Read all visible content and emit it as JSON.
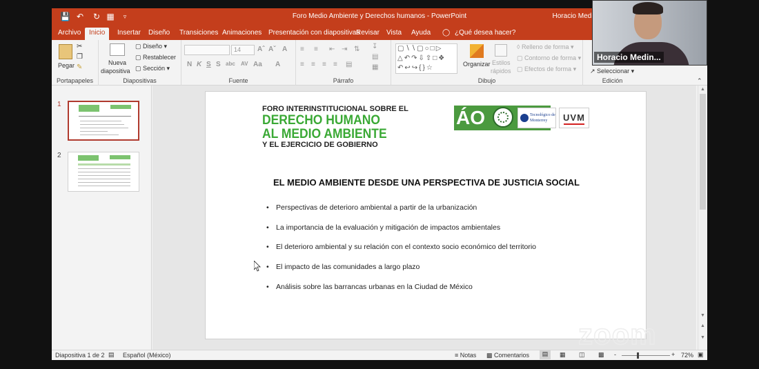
{
  "window": {
    "title": "Foro Medio Ambiente y Derechos humanos  -  PowerPoint",
    "user": "Horacio Medin"
  },
  "quick_access": {
    "icons": [
      "save-icon",
      "undo-icon",
      "redo-icon",
      "presenter-icon",
      "customize-icon"
    ]
  },
  "tabs": [
    "Archivo",
    "Inicio",
    "Insertar",
    "Diseño",
    "Transiciones",
    "Animaciones",
    "Presentación con diapositivas",
    "Revisar",
    "Vista",
    "Ayuda"
  ],
  "active_tab": "Inicio",
  "tell_me": "¿Qué desea hacer?",
  "ribbon": {
    "portapapeles": {
      "label": "Portapapeles",
      "paste": "Pegar"
    },
    "diapositivas": {
      "label": "Diapositivas",
      "nueva": "Nueva",
      "nueva2": "diapositiva",
      "diseno": "Diseño",
      "restablecer": "Restablecer",
      "seccion": "Sección"
    },
    "fuente": {
      "label": "Fuente",
      "size": "14"
    },
    "parrafo": {
      "label": "Párrafo"
    },
    "dibujo": {
      "label": "Dibujo",
      "organizar": "Organizar",
      "estilos1": "Estilos",
      "estilos2": "rápidos",
      "relleno": "Relleno de forma",
      "contorno": "Contorno de forma",
      "efectos": "Efectos de forma"
    },
    "edicion": {
      "label": "Edición",
      "seleccionar": "Seleccionar"
    }
  },
  "thumbnails": [
    {
      "number": "1",
      "selected": true
    },
    {
      "number": "2",
      "selected": false
    }
  ],
  "slide": {
    "logo_line1": "FORO INTERINSTITUCIONAL SOBRE EL",
    "logo_line2": "DERECHO HUMANO",
    "logo_line3": "AL MEDIO AMBIENTE",
    "logo_line4": "Y EL EJERCICIO DE GOBIERNO",
    "ao_logo": "ÁO",
    "tec_logo": "Tecnológico de Monterrey",
    "uvm_logo": "UVM",
    "title": "EL MEDIO AMBIENTE DESDE UNA PERSPECTIVA DE JUSTICIA SOCIAL",
    "bullets": [
      "Perspectivas de deterioro ambiental a partir de la urbanización",
      "La importancia de la evaluación y mitigación de impactos ambientales",
      "El deterioro ambiental y su relación con el contexto socio económico del territorio",
      "El impacto de las comunidades a largo plazo",
      "Análisis sobre las barrancas urbanas en la Ciudad de México"
    ]
  },
  "statusbar": {
    "slide_count": "Diapositiva 1 de 2",
    "language": "Español (México)",
    "notes": "Notas",
    "comments": "Comentarios",
    "zoom_minus": "-",
    "zoom_plus": "+",
    "zoom": "72%"
  },
  "webcam": {
    "name": "Horacio Medin..."
  },
  "watermark": "zoom",
  "colors": {
    "accent": "#c43e1c",
    "logo_green": "#3aa935"
  }
}
